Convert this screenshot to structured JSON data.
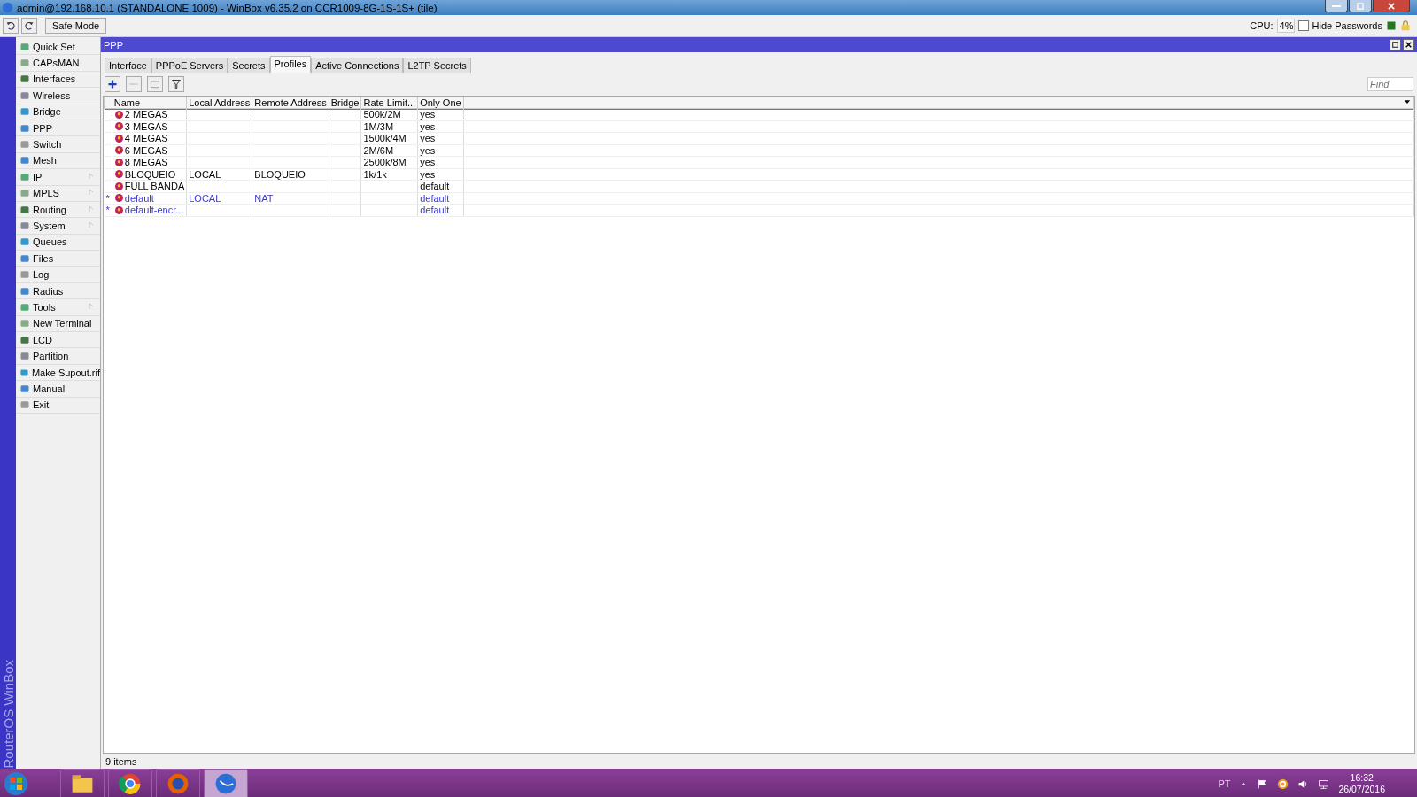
{
  "window": {
    "title": "admin@192.168.10.1 (STANDALONE 1009) - WinBox v6.35.2 on CCR1009-8G-1S-1S+ (tile)"
  },
  "toolbar": {
    "safe_mode": "Safe Mode",
    "cpu_label": "CPU:",
    "cpu_value": "4%",
    "hide_passwords": {
      "label": "Hide Passwords",
      "checked": false
    }
  },
  "side_banner": "RouterOS WinBox",
  "sidebar": {
    "items": [
      {
        "label": "Quick Set",
        "submenu": false
      },
      {
        "label": "CAPsMAN",
        "submenu": false
      },
      {
        "label": "Interfaces",
        "submenu": false
      },
      {
        "label": "Wireless",
        "submenu": false
      },
      {
        "label": "Bridge",
        "submenu": false
      },
      {
        "label": "PPP",
        "submenu": false
      },
      {
        "label": "Switch",
        "submenu": false
      },
      {
        "label": "Mesh",
        "submenu": false
      },
      {
        "label": "IP",
        "submenu": true
      },
      {
        "label": "MPLS",
        "submenu": true
      },
      {
        "label": "Routing",
        "submenu": true
      },
      {
        "label": "System",
        "submenu": true
      },
      {
        "label": "Queues",
        "submenu": false
      },
      {
        "label": "Files",
        "submenu": false
      },
      {
        "label": "Log",
        "submenu": false
      },
      {
        "label": "Radius",
        "submenu": false
      },
      {
        "label": "Tools",
        "submenu": true
      },
      {
        "label": "New Terminal",
        "submenu": false
      },
      {
        "label": "LCD",
        "submenu": false
      },
      {
        "label": "Partition",
        "submenu": false
      },
      {
        "label": "Make Supout.rif",
        "submenu": false
      },
      {
        "label": "Manual",
        "submenu": false
      },
      {
        "label": "Exit",
        "submenu": false
      }
    ]
  },
  "ppp_window": {
    "title": "PPP",
    "tabs": [
      {
        "label": "Interface",
        "selected": false
      },
      {
        "label": "PPPoE Servers",
        "selected": false
      },
      {
        "label": "Secrets",
        "selected": false
      },
      {
        "label": "Profiles",
        "selected": true
      },
      {
        "label": "Active Connections",
        "selected": false
      },
      {
        "label": "L2TP Secrets",
        "selected": false
      }
    ],
    "find": {
      "placeholder": "Find"
    },
    "table": {
      "columns": [
        "Name",
        "Local Address",
        "Remote Address",
        "Bridge",
        "Rate Limit...",
        "Only One"
      ],
      "rows": [
        {
          "flag": "",
          "default": false,
          "focused": true,
          "cells": [
            "2 MEGAS",
            "",
            "",
            "",
            "500k/2M",
            "yes"
          ]
        },
        {
          "flag": "",
          "default": false,
          "focused": false,
          "cells": [
            "3 MEGAS",
            "",
            "",
            "",
            "1M/3M",
            "yes"
          ]
        },
        {
          "flag": "",
          "default": false,
          "focused": false,
          "cells": [
            "4 MEGAS",
            "",
            "",
            "",
            "1500k/4M",
            "yes"
          ]
        },
        {
          "flag": "",
          "default": false,
          "focused": false,
          "cells": [
            "6 MEGAS",
            "",
            "",
            "",
            "2M/6M",
            "yes"
          ]
        },
        {
          "flag": "",
          "default": false,
          "focused": false,
          "cells": [
            "8 MEGAS",
            "",
            "",
            "",
            "2500k/8M",
            "yes"
          ]
        },
        {
          "flag": "",
          "default": false,
          "focused": false,
          "cells": [
            "BLOQUEIO",
            "LOCAL",
            "BLOQUEIO",
            "",
            "1k/1k",
            "yes"
          ]
        },
        {
          "flag": "",
          "default": false,
          "focused": false,
          "cells": [
            "FULL BANDA",
            "",
            "",
            "",
            "",
            "default"
          ]
        },
        {
          "flag": "*",
          "default": true,
          "focused": false,
          "cells": [
            "default",
            "LOCAL",
            "NAT",
            "",
            "",
            "default"
          ]
        },
        {
          "flag": "*",
          "default": true,
          "focused": false,
          "cells": [
            "default-encr...",
            "",
            "",
            "",
            "",
            "default"
          ]
        }
      ]
    },
    "status": "9 items"
  },
  "taskbar": {
    "apps": [
      {
        "selected": false
      },
      {
        "selected": false
      },
      {
        "selected": false
      },
      {
        "selected": true
      }
    ],
    "tray": {
      "language": "PT",
      "time": "16:32",
      "date": "26/07/2016"
    }
  }
}
